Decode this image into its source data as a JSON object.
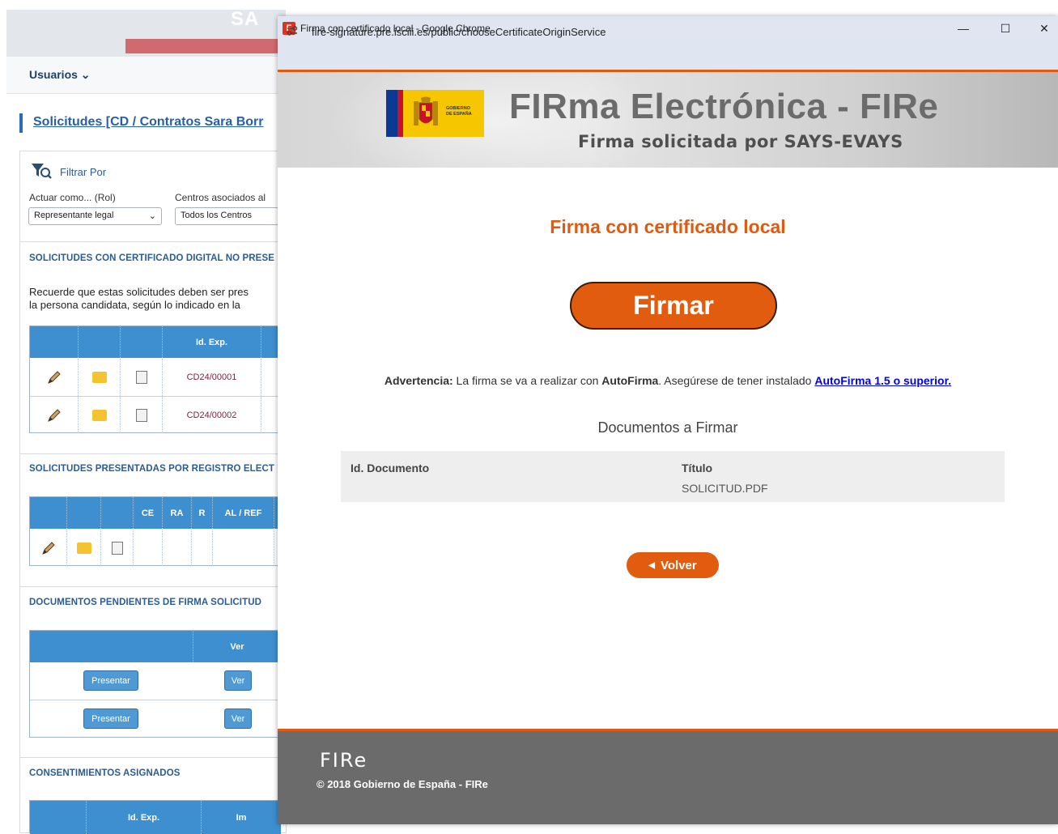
{
  "background_page": {
    "banner_logo_partial": "SA",
    "nav_user": "Usuarios ⌄",
    "title": "Solicitudes [CD / Contratos Sara Borr",
    "filter_label": "Filtrar Por",
    "role_label": "Actuar como... (Rol)",
    "centros_label": "Centros asociados al",
    "role_select": "Representante legal",
    "centros_select": "Todos los Centros",
    "section1": "SOLICITUDES CON CERTIFICADO DIGITAL NO PRESE",
    "notice_line1": "Recuerde que estas solicitudes deben ser pres",
    "notice_line2": "la persona candidata, según lo indicado en la",
    "table1": {
      "header_exp": "Id. Exp.",
      "rows": [
        "CD24/00001",
        "CD24/00002"
      ]
    },
    "section2": "SOLICITUDES PRESENTADAS POR REGISTRO ELECT",
    "table2": {
      "headers": [
        "CE",
        "RA",
        "R",
        "AL / REF"
      ]
    },
    "section3": "DOCUMENTOS PENDIENTES DE FIRMA SOLICITUD",
    "table3": {
      "header_ver": "Ver",
      "presentar": "Presentar",
      "ver": "Ver"
    },
    "section4": "CONSENTIMIENTOS ASIGNADOS",
    "table4": {
      "header_exp": "Id. Exp.",
      "header_partial": "Im"
    }
  },
  "window": {
    "title": "Firma con certificado local - Google Chrome",
    "favicon": "F",
    "url": "fire-signature.pre.isciii.es/public/chooseCertificateOriginService",
    "controls": {
      "minimize": "—",
      "maximize": "☐",
      "close": "✕"
    }
  },
  "header": {
    "logo_text_line1": "GOBIERNO",
    "logo_text_line2": "DE ESPAÑA",
    "title": "FIRma Electrónica - FIRe",
    "subtitle": "Firma solicitada por SAYS-EVAYS"
  },
  "content": {
    "heading": "Firma con certificado local",
    "sign_button": "Firmar",
    "warning_label": "Advertencia:",
    "warning_text1": " La firma se va a realizar con ",
    "warning_app": "AutoFirma",
    "warning_text2": ". Asegúrese de tener instalado ",
    "warning_link": "AutoFirma 1.5 o superior",
    "warning_end": ".",
    "docs_heading": "Documentos a Firmar",
    "docs_table": {
      "col_id": "Id. Documento",
      "col_title": "Título",
      "rows": [
        {
          "id": "",
          "title": "SOLICITUD.PDF"
        }
      ]
    },
    "back_button": "Volver"
  },
  "footer": {
    "logo": "FIRe",
    "copyright": "© 2018 Gobierno de España - FIRe"
  },
  "colors": {
    "accent": "#e25c10",
    "footer_bg": "#6b6b6b",
    "table_header": "#3d8fd0"
  }
}
